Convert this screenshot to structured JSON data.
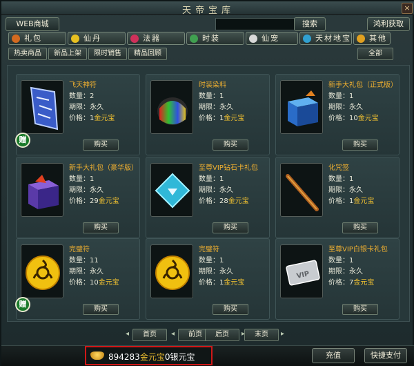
{
  "window": {
    "title": "天帝宝库",
    "close": "×"
  },
  "toolbar": {
    "web_store": "WEB商城",
    "search": "搜索",
    "bonus": "鸿利获取"
  },
  "categories": [
    {
      "label": "礼包",
      "icon": "gift-bag-icon",
      "color": "#d46a20"
    },
    {
      "label": "仙丹",
      "icon": "pill-icon",
      "color": "#e8c020"
    },
    {
      "label": "法器",
      "icon": "magic-wand-icon",
      "color": "#d0305a"
    },
    {
      "label": "时装",
      "icon": "costume-icon",
      "color": "#40a050"
    },
    {
      "label": "仙宠",
      "icon": "pet-icon",
      "color": "#d8d8d8"
    },
    {
      "label": "天材地宝",
      "icon": "treasure-icon",
      "color": "#30a0d0"
    },
    {
      "label": "其他",
      "icon": "other-icon",
      "color": "#e0a020"
    }
  ],
  "subtabs": [
    "热卖商品",
    "新品上架",
    "限时销售",
    "精品回顾"
  ],
  "all_label": "全部",
  "labels": {
    "qty": "数量：",
    "period": "期限：",
    "price": "价格：",
    "currency": "金元宝",
    "buy": "购买",
    "gift": "赠"
  },
  "items": [
    {
      "name": "飞天神符",
      "qty": "2",
      "period": "永久",
      "price": "1",
      "gift": true,
      "thumb": "talisman"
    },
    {
      "name": "时装染料",
      "qty": "1",
      "period": "永久",
      "price": "1",
      "gift": false,
      "thumb": "dye"
    },
    {
      "name": "新手大礼包（正式版）",
      "qty": "1",
      "period": "永久",
      "price": "10",
      "gift": false,
      "thumb": "box-blue"
    },
    {
      "name": "新手大礼包（豪华版）",
      "qty": "1",
      "period": "永久",
      "price": "29",
      "gift": false,
      "thumb": "box-purple"
    },
    {
      "name": "至尊VIP钻石卡礼包",
      "qty": "1",
      "period": "永久",
      "price": "28",
      "gift": false,
      "thumb": "diamond-card"
    },
    {
      "name": "化咒签",
      "qty": "1",
      "period": "永久",
      "price": "1",
      "gift": false,
      "thumb": "stick"
    },
    {
      "name": "完璧符",
      "qty": "11",
      "period": "永久",
      "price": "10",
      "gift": true,
      "thumb": "coin"
    },
    {
      "name": "完璧符",
      "qty": "1",
      "period": "永久",
      "price": "1",
      "gift": false,
      "thumb": "coin"
    },
    {
      "name": "至尊VIP白银卡礼包",
      "qty": "1",
      "period": "永久",
      "price": "7",
      "gift": false,
      "thumb": "silver-card"
    }
  ],
  "pagination": {
    "first": "首页",
    "prev": "前页",
    "next": "后页",
    "last": "末页"
  },
  "balance": {
    "gold": "894283",
    "gold_unit": "金元宝",
    "silver": "0",
    "silver_unit": "银元宝"
  },
  "bottom": {
    "recharge": "充值",
    "quick_pay": "快捷支付"
  }
}
